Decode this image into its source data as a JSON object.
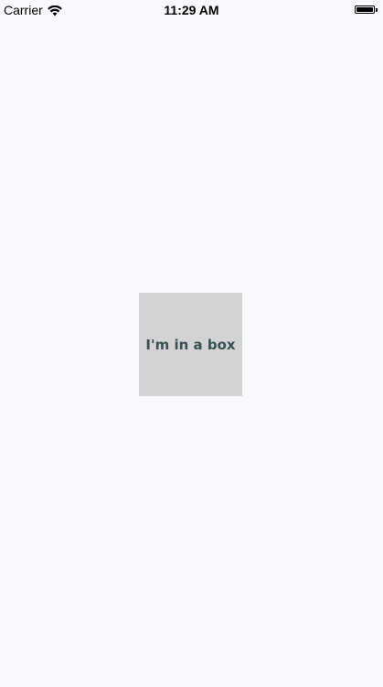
{
  "status_bar": {
    "carrier": "Carrier",
    "time": "11:29 AM",
    "wifi_icon": "wifi-icon",
    "battery_icon": "battery-icon",
    "battery_level": 1.0
  },
  "box": {
    "label": "I'm in a box",
    "background": "#d3d3d3",
    "text_color": "#385254"
  },
  "colors": {
    "background": "#f8f9fd"
  }
}
